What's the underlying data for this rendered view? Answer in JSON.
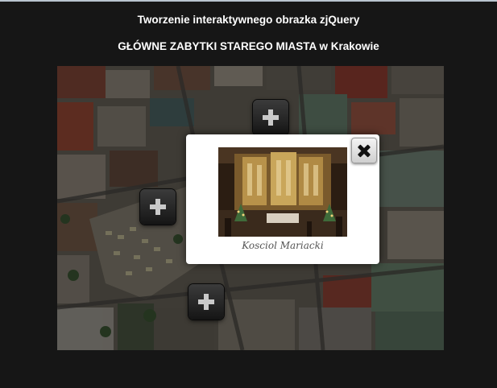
{
  "page": {
    "title": "Tworzenie interaktywnego obrazka zjQuery",
    "subtitle": "GŁÓWNE ZABYTKI STAREGO MIASTA w Krakowie"
  },
  "map": {
    "image": "aerial-krakow-old-town-image",
    "hotspots": [
      {
        "icon": "plus-icon"
      },
      {
        "icon": "plus-icon"
      },
      {
        "icon": "plus-icon"
      }
    ]
  },
  "popup": {
    "image": "church-altar-photo",
    "caption": "Kosciol Mariacki",
    "close_icon": "close-icon"
  },
  "colors": {
    "background": "#161616",
    "popup_background": "#ffffff",
    "text": "#ffffff"
  }
}
